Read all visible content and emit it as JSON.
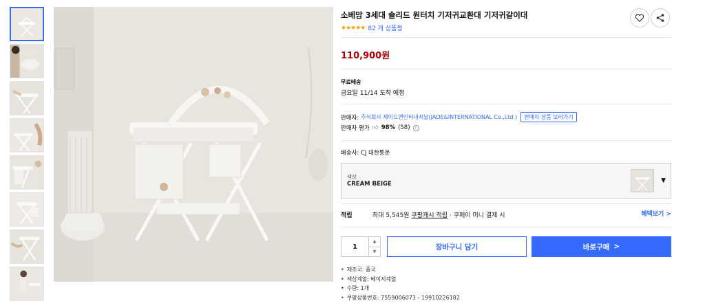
{
  "product": {
    "title": "소베맘 3세대 솔리드 원터치 기저귀교환대 기저귀갈이대",
    "stars": "★★★★★",
    "review_count": "82 개 상품평",
    "price": "110,900원"
  },
  "shipping": {
    "label": "무료배송",
    "arrival": "금요일 11/14 도착 예정",
    "carrier_label": "배송사:",
    "carrier": "CJ 대한통운"
  },
  "seller": {
    "label": "판매자:",
    "name": "주식회사 제이드앤인터내셔날(JADE&INTERNATIONAL Co.,Ltd.)",
    "view_products": "판매자 상품 보러가기",
    "eval_label": "판매자 평가",
    "eval_value": "98%",
    "eval_count": "(58)"
  },
  "option": {
    "label": "색상",
    "value": "CREAM BEIGE"
  },
  "reward": {
    "title": "적립",
    "prefix": "최대 5,545원",
    "link": "쿠팡캐시 적립",
    "suffix": "· 쿠페이 머니 결제 시",
    "benefit": "혜택보기 >"
  },
  "purchase": {
    "quantity": "1",
    "cart_label": "장바구니 담기",
    "buy_label": "바로구매",
    "buy_arrow": ">"
  },
  "specs": [
    "제조국: 중국",
    "색상계열: 베이지계열",
    "수량: 1개",
    "쿠팡상품번호: 7559006073 - 19910226182"
  ],
  "colors": {
    "accent": "#346aff",
    "price": "#ae0000",
    "star": "#f59b00"
  },
  "icons": {
    "wish": "heart-icon",
    "share": "share-icon"
  }
}
